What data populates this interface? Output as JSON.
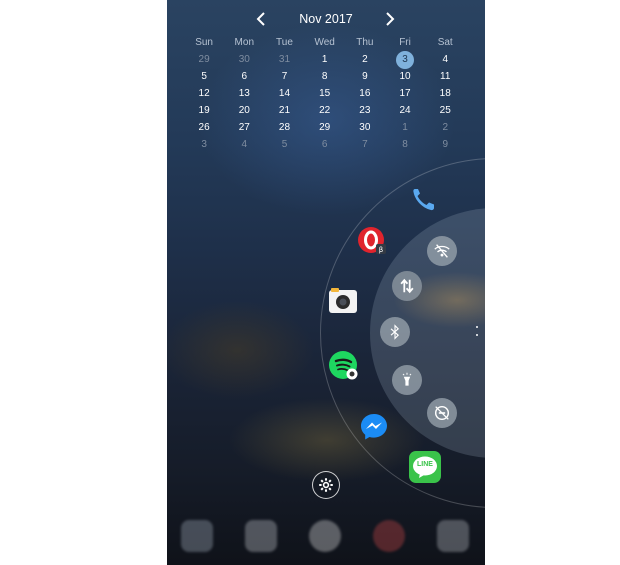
{
  "calendar": {
    "title": "Nov 2017",
    "weekdays": [
      "Sun",
      "Mon",
      "Tue",
      "Wed",
      "Thu",
      "Fri",
      "Sat"
    ],
    "weeks": [
      [
        "29",
        "30",
        "31",
        "1",
        "2",
        "3",
        "4"
      ],
      [
        "5",
        "6",
        "7",
        "8",
        "9",
        "10",
        "11"
      ],
      [
        "12",
        "13",
        "14",
        "15",
        "16",
        "17",
        "18"
      ],
      [
        "19",
        "20",
        "21",
        "22",
        "23",
        "24",
        "25"
      ],
      [
        "26",
        "27",
        "28",
        "29",
        "30",
        "1",
        "2"
      ],
      [
        "3",
        "4",
        "5",
        "6",
        "7",
        "8",
        "9"
      ]
    ],
    "today": "3"
  },
  "apps_panel": {
    "apps": [
      {
        "name": "phone",
        "icon": "phone-icon"
      },
      {
        "name": "opera-beta",
        "icon": "opera-beta-icon"
      },
      {
        "name": "camera",
        "icon": "camera-icon"
      },
      {
        "name": "spotify",
        "icon": "spotify-icon"
      },
      {
        "name": "messenger",
        "icon": "messenger-icon"
      },
      {
        "name": "line",
        "icon": "line-icon",
        "label": "LINE"
      }
    ]
  },
  "quick_settings": [
    {
      "name": "wifi",
      "icon": "wifi-off-icon",
      "state": "off"
    },
    {
      "name": "mobile-data",
      "icon": "data-transfer-icon",
      "state": "on"
    },
    {
      "name": "bluetooth",
      "icon": "bluetooth-icon",
      "state": "off"
    },
    {
      "name": "flashlight",
      "icon": "flashlight-icon",
      "state": "off"
    },
    {
      "name": "do-not-disturb",
      "icon": "do-not-disturb-icon",
      "state": "off"
    }
  ],
  "colors": {
    "today_highlight": "#7fb1dc",
    "spotify": "#1ed760",
    "line": "#3ac34a",
    "messenger": "#1b8cf5",
    "opera": "#e0242d"
  }
}
